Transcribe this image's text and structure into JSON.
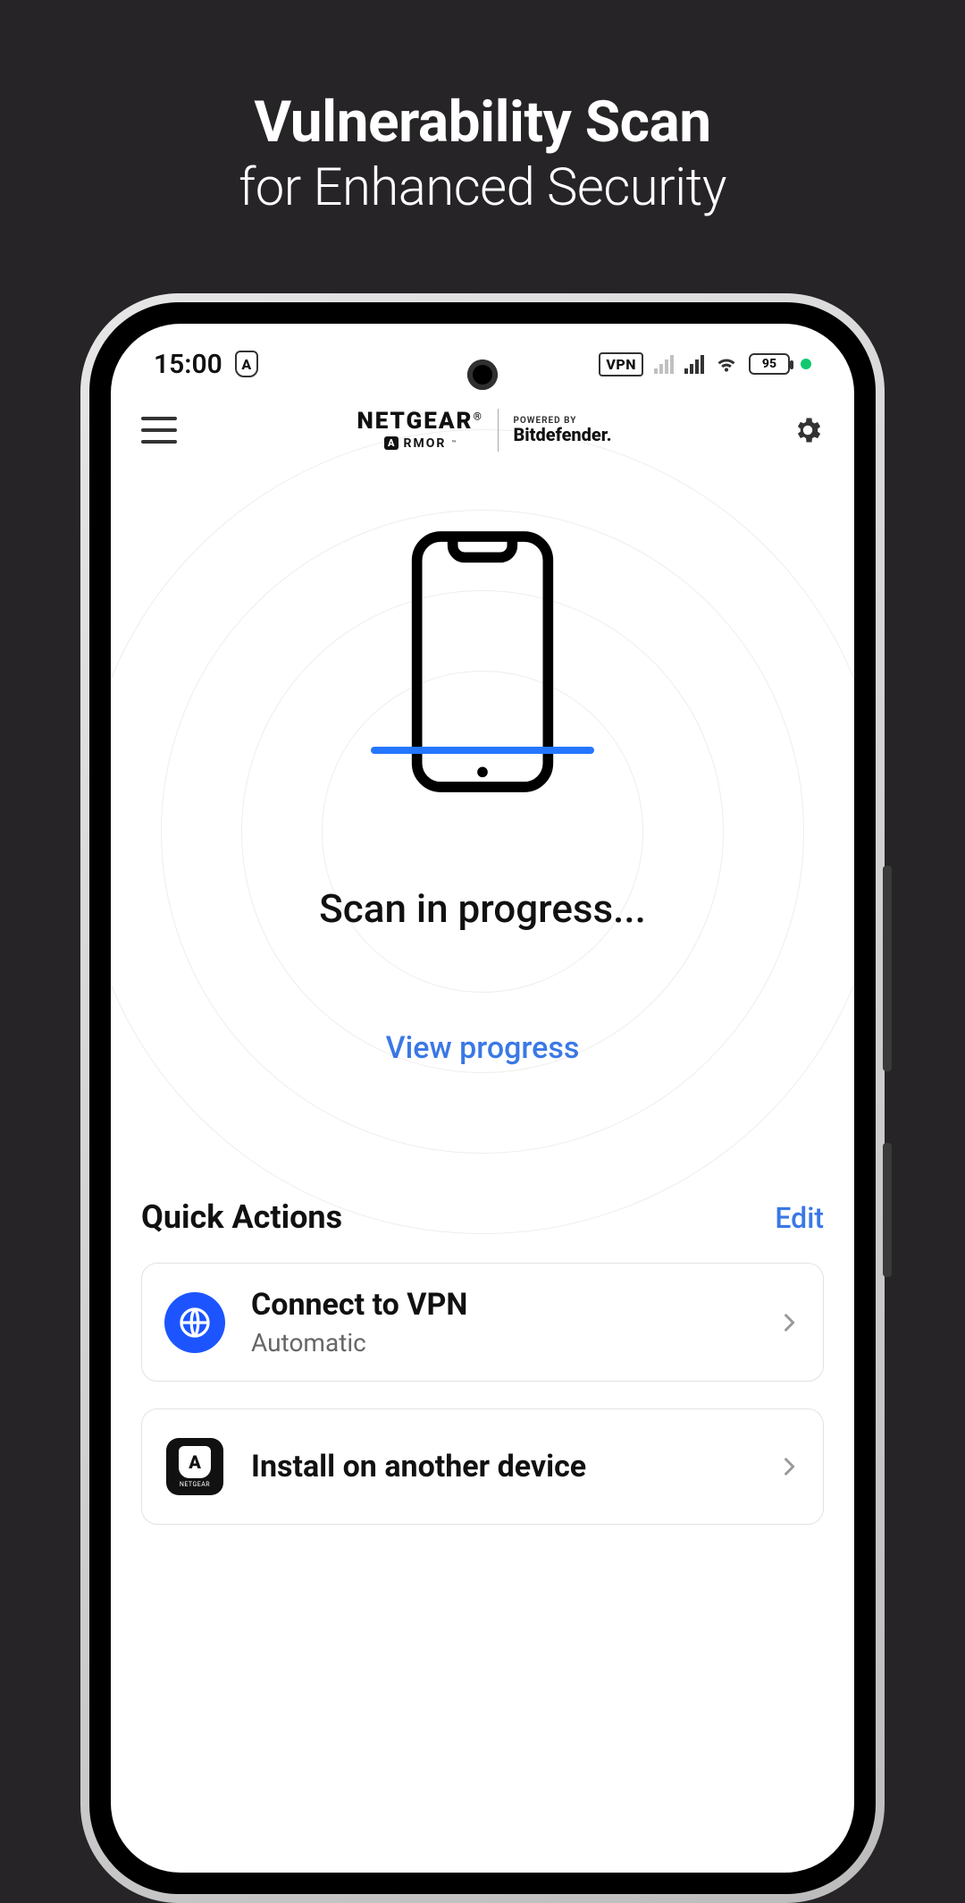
{
  "promo": {
    "title": "Vulnerability Scan",
    "subtitle": "for Enhanced Security"
  },
  "statusbar": {
    "time": "15:00",
    "vpn_label": "VPN",
    "battery": "95"
  },
  "header": {
    "brand_primary": "NETGEAR",
    "brand_secondary": "RMOR",
    "powered_by": "POWERED BY",
    "partner": "Bitdefender."
  },
  "scan": {
    "status": "Scan in progress...",
    "view_progress": "View progress"
  },
  "quick_actions": {
    "title": "Quick Actions",
    "edit": "Edit",
    "items": [
      {
        "title": "Connect to VPN",
        "subtitle": "Automatic",
        "icon": "globe"
      },
      {
        "title": "Install on another device",
        "subtitle": "",
        "icon": "armor"
      }
    ]
  }
}
